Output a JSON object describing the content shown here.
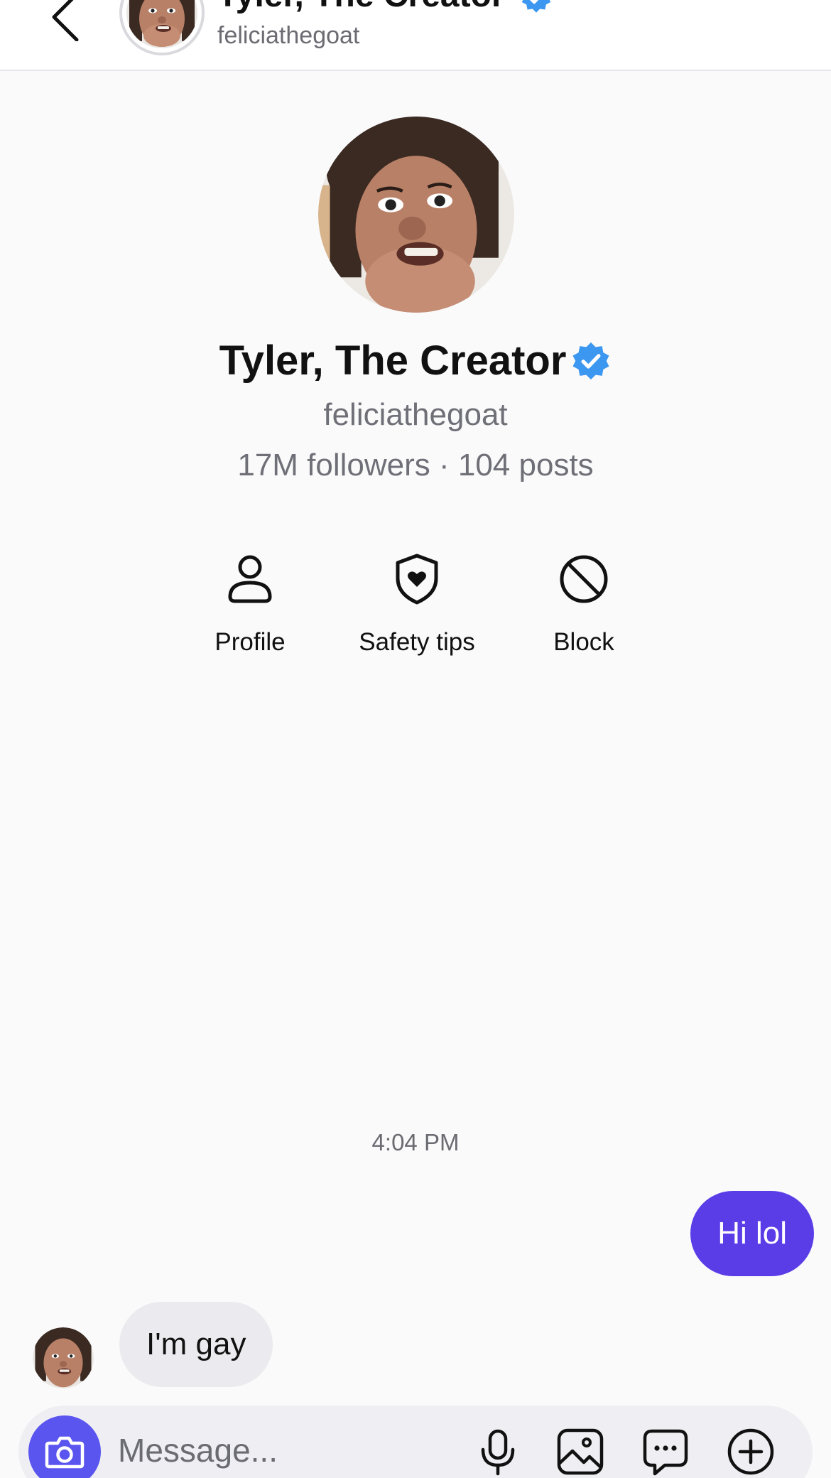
{
  "header": {
    "title": "Tyler, The Creator",
    "username": "feliciathegoat"
  },
  "profile": {
    "name": "Tyler, The Creator",
    "username": "feliciathegoat",
    "stats": "17M followers · 104 posts"
  },
  "actions": [
    {
      "label": "Profile",
      "icon": "person-icon"
    },
    {
      "label": "Safety tips",
      "icon": "shield-heart-icon"
    },
    {
      "label": "Block",
      "icon": "block-icon"
    }
  ],
  "chat": {
    "timestamp": "4:04 PM",
    "messages": [
      {
        "from": "me",
        "text": "Hi lol"
      },
      {
        "from": "them",
        "text": "I'm gay"
      }
    ]
  },
  "composer": {
    "placeholder": "Message...",
    "icons": [
      "camera-icon",
      "microphone-icon",
      "image-icon",
      "chat-bubble-icon",
      "plus-icon"
    ]
  },
  "colors": {
    "accent": "#5b3de8",
    "camera": "#5b55f0",
    "verified": "#3b97f0",
    "incoming_bubble": "#ebebef"
  }
}
